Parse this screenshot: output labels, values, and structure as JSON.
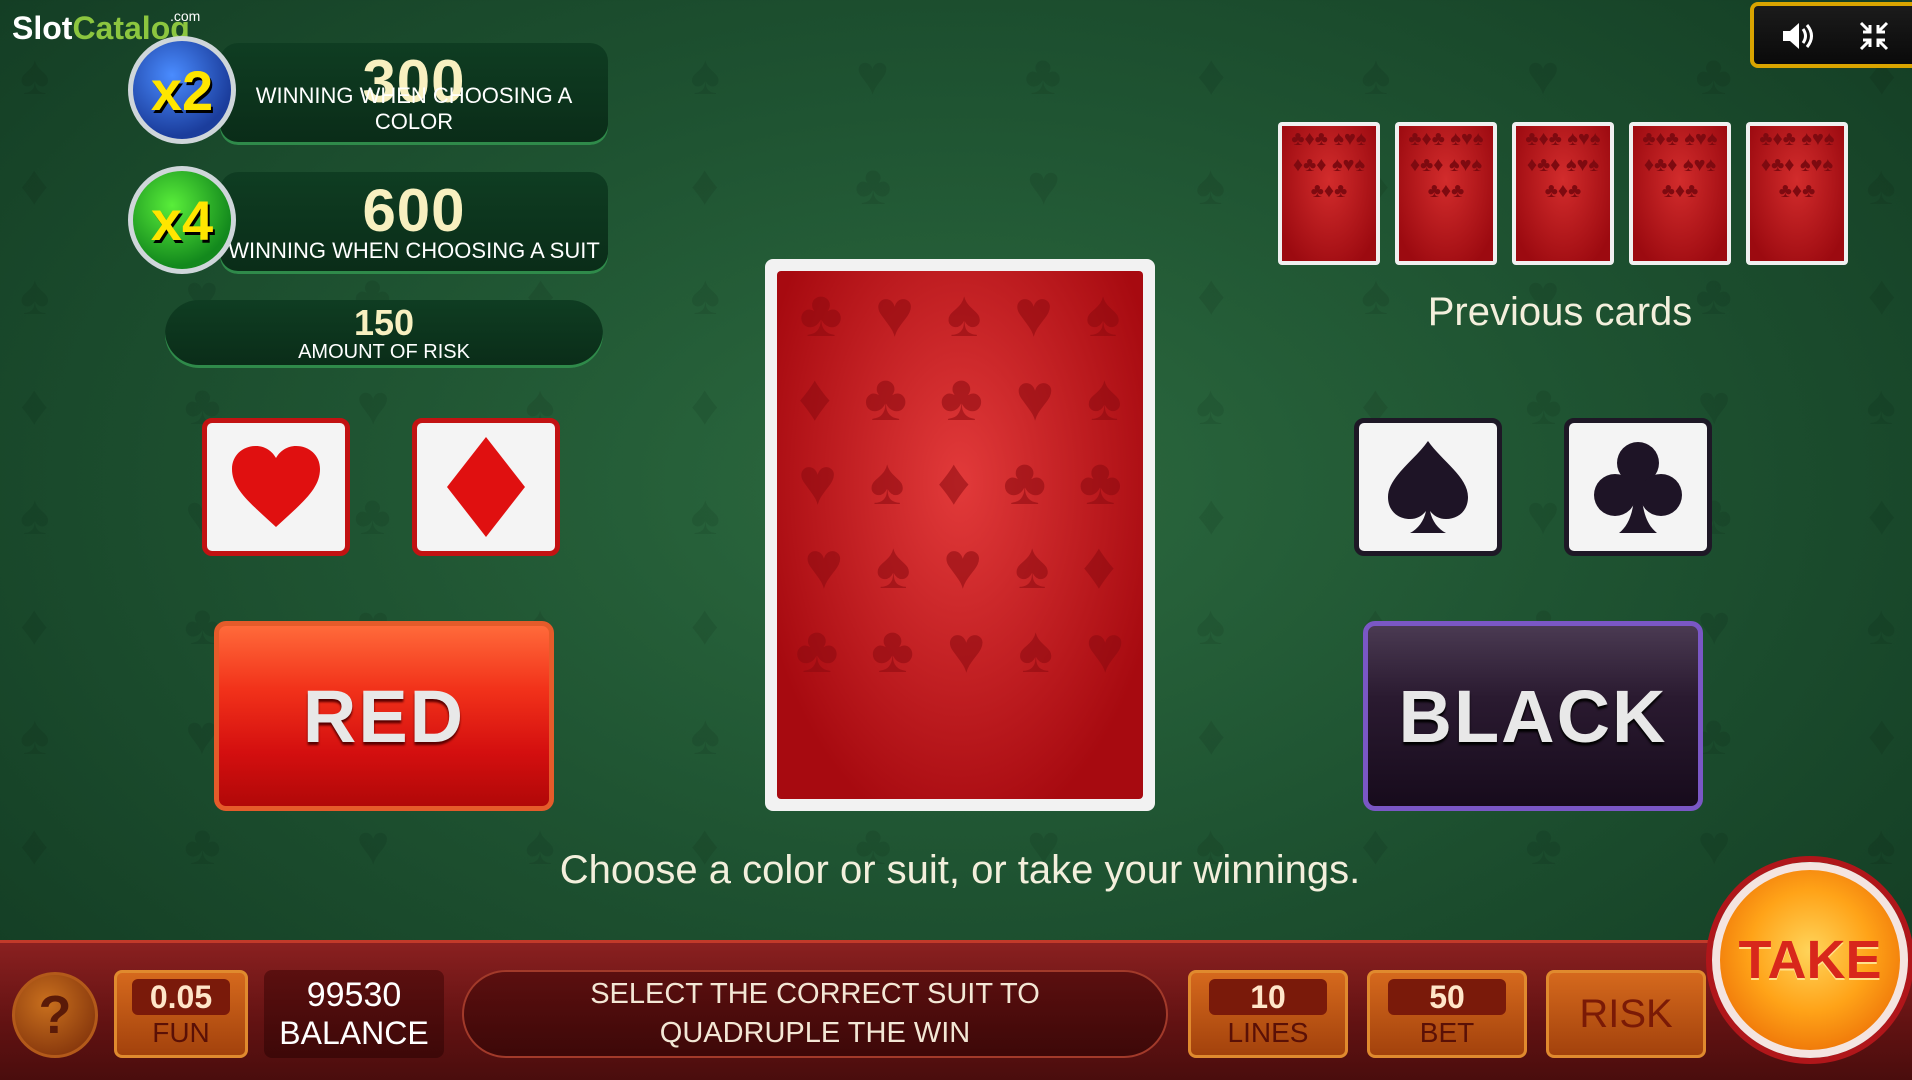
{
  "logo": {
    "slot": "Slot",
    "catalog": "Catalog",
    "com": ".com"
  },
  "controls": {
    "sound_icon": "speaker-icon",
    "minimize_icon": "collapse-icon"
  },
  "color_bet": {
    "multiplier": "x2",
    "value": "300",
    "label": "WINNING WHEN CHOOSING A COLOR"
  },
  "suit_bet": {
    "multiplier": "x4",
    "value": "600",
    "label": "WINNING WHEN CHOOSING A SUIT"
  },
  "risk": {
    "value": "150",
    "label": "AMOUNT OF RISK"
  },
  "suits": {
    "hearts": {
      "glyph": "♥",
      "color": "#e01010"
    },
    "diamonds": {
      "glyph": "♦",
      "color": "#e01010"
    },
    "spades": {
      "glyph": "♠",
      "color": "#1e1426"
    },
    "clubs": {
      "glyph": "♣",
      "color": "#1e1426"
    }
  },
  "buttons": {
    "red": "RED",
    "black": "BLACK",
    "take": "TAKE",
    "risk": "RISK",
    "help": "?"
  },
  "previous_cards": {
    "label": "Previous cards",
    "count": 5
  },
  "instruction": "Choose a color or suit, or take your winnings.",
  "bottom": {
    "fun_value": "0.05",
    "fun_label": "FUN",
    "balance_value": "99530",
    "balance_label": "BALANCE",
    "message": "SELECT THE CORRECT SUIT TO QUADRUPLE THE WIN",
    "lines_value": "10",
    "lines_label": "LINES",
    "bet_value": "50",
    "bet_label": "BET"
  },
  "colors": {
    "felt": "#1f5432",
    "bar": "#611212",
    "accent": "#d5691d"
  }
}
